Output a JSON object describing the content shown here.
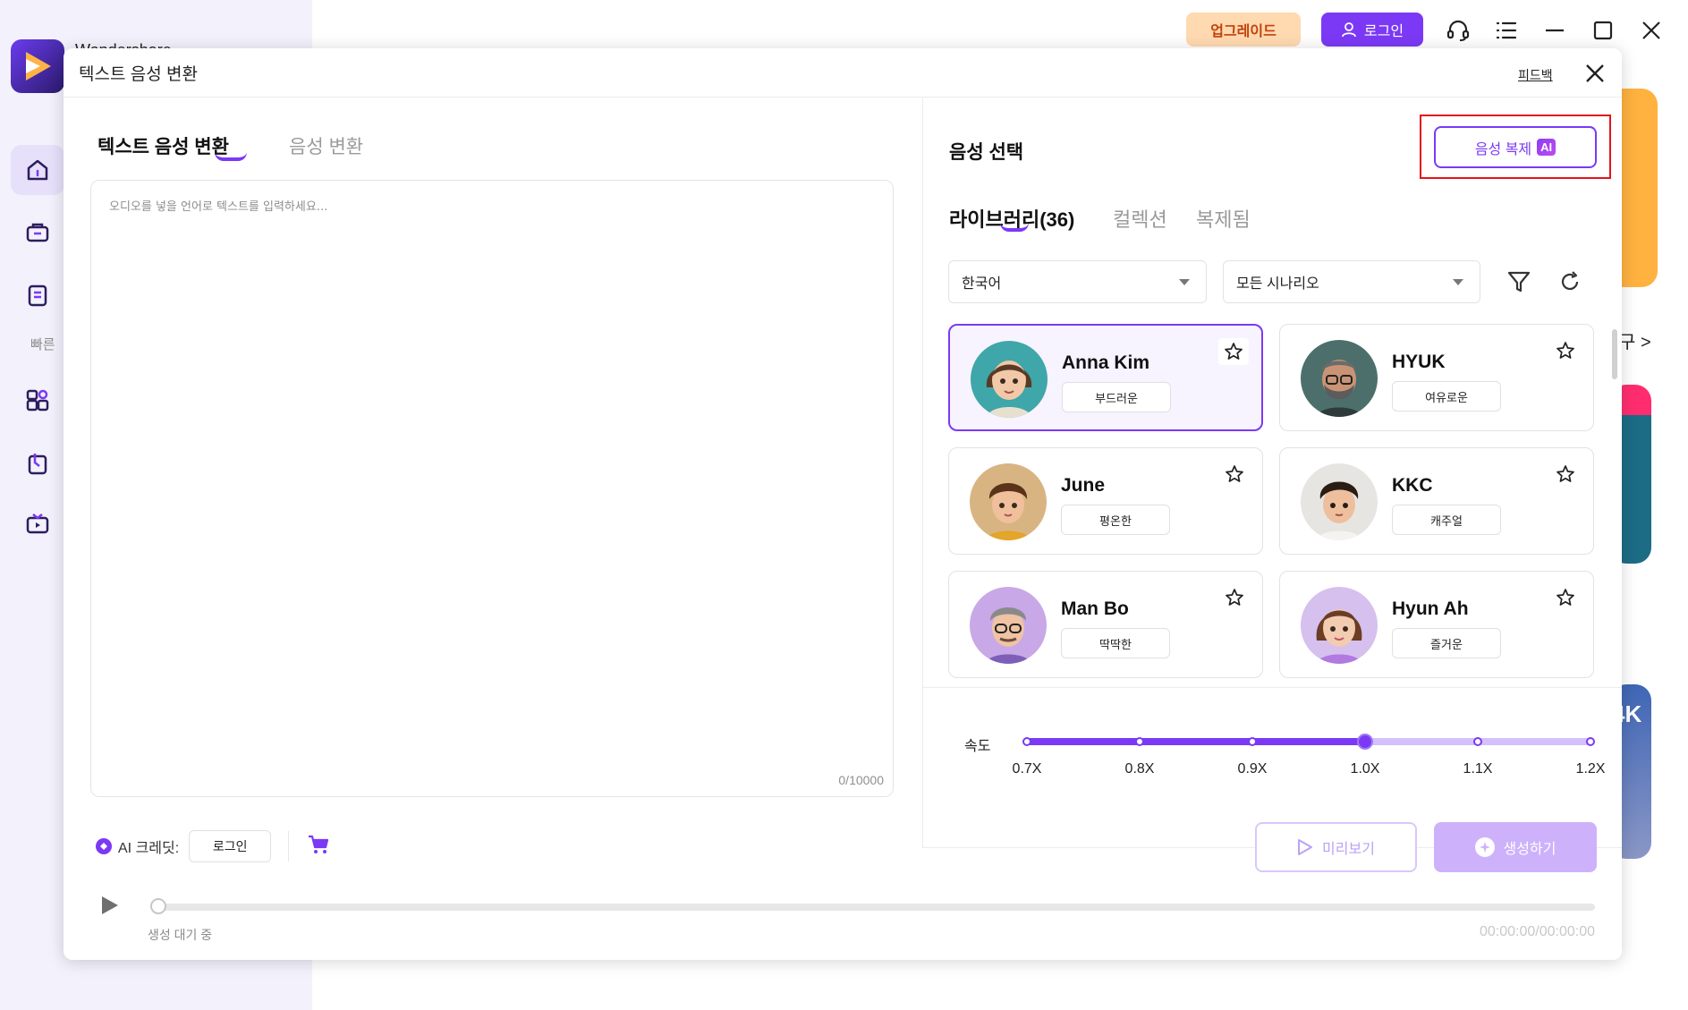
{
  "background_app": {
    "app_name": "Wondershare",
    "quick_label": "빠른",
    "more_link": "구 >",
    "topbar": {
      "upgrade_label": "업그레이드",
      "login_label": "로그인"
    },
    "card_badge": "4K"
  },
  "dialog": {
    "title": "텍스트 음성 변환",
    "feedback_label": "피드백",
    "tabs": [
      {
        "label": "텍스트 음성 변환",
        "active": true
      },
      {
        "label": "음성 변환",
        "active": false
      }
    ],
    "text_input": {
      "placeholder": "오디오를 넣을 언어로 텍스트를 입력하세요...",
      "value": "",
      "char_count": "0/10000"
    },
    "credits": {
      "label": "AI 크레딧:",
      "login_label": "로그인"
    },
    "voice_panel": {
      "title": "음성 선택",
      "clone_label": "음성 복제",
      "clone_badge": "AI",
      "tabs": [
        {
          "label": "라이브러리(36)",
          "active": true
        },
        {
          "label": "컬렉션",
          "active": false
        },
        {
          "label": "복제됨",
          "active": false
        }
      ],
      "language_select": "한국어",
      "scenario_select": "모든 시나리오",
      "voices": [
        {
          "name": "Anna Kim",
          "tag": "부드러운",
          "selected": true
        },
        {
          "name": "HYUK",
          "tag": "여유로운",
          "selected": false
        },
        {
          "name": "June",
          "tag": "평온한",
          "selected": false
        },
        {
          "name": "KKC",
          "tag": "캐주얼",
          "selected": false
        },
        {
          "name": "Man Bo",
          "tag": "딱딱한",
          "selected": false
        },
        {
          "name": "Hyun Ah",
          "tag": "즐거운",
          "selected": false
        }
      ]
    },
    "speed": {
      "label": "속도",
      "ticks": [
        "0.7X",
        "0.8X",
        "0.9X",
        "1.0X",
        "1.1X",
        "1.2X"
      ],
      "value": "1.0X",
      "value_index": 3
    },
    "actions": {
      "preview_label": "미리보기",
      "generate_label": "생성하기"
    },
    "player": {
      "status": "생성 대기 중",
      "time": "00:00:00/00:00:00",
      "progress": 0
    }
  },
  "colors": {
    "accent": "#7b39f5",
    "highlight": "#e2141b",
    "upgrade_bg": "#ffd9b0"
  }
}
